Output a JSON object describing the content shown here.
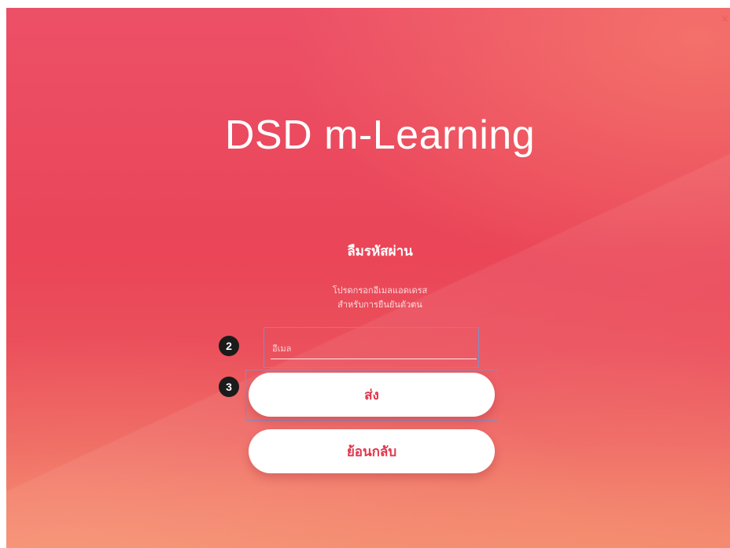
{
  "app": {
    "title": "DSD m-Learning",
    "close_glyph": "×"
  },
  "form": {
    "heading": "ลืมรหัสผ่าน",
    "instruction_line1": "โปรดกรอกอีเมลแอดเดรส",
    "instruction_line2": "สำหรับการยืนยันตัวตน",
    "email_placeholder": "อีเมล",
    "email_value": "",
    "submit_label": "ส่ง",
    "back_label": "ย้อนกลับ"
  },
  "annotations": {
    "email_marker": "2",
    "submit_marker": "3"
  },
  "colors": {
    "background_primary": "#ea4558",
    "button_text": "#e2354b",
    "annotation_box": "#7b8fc8",
    "marker_bg": "#1b1b1b"
  },
  "icons": {
    "close": "close-icon"
  }
}
